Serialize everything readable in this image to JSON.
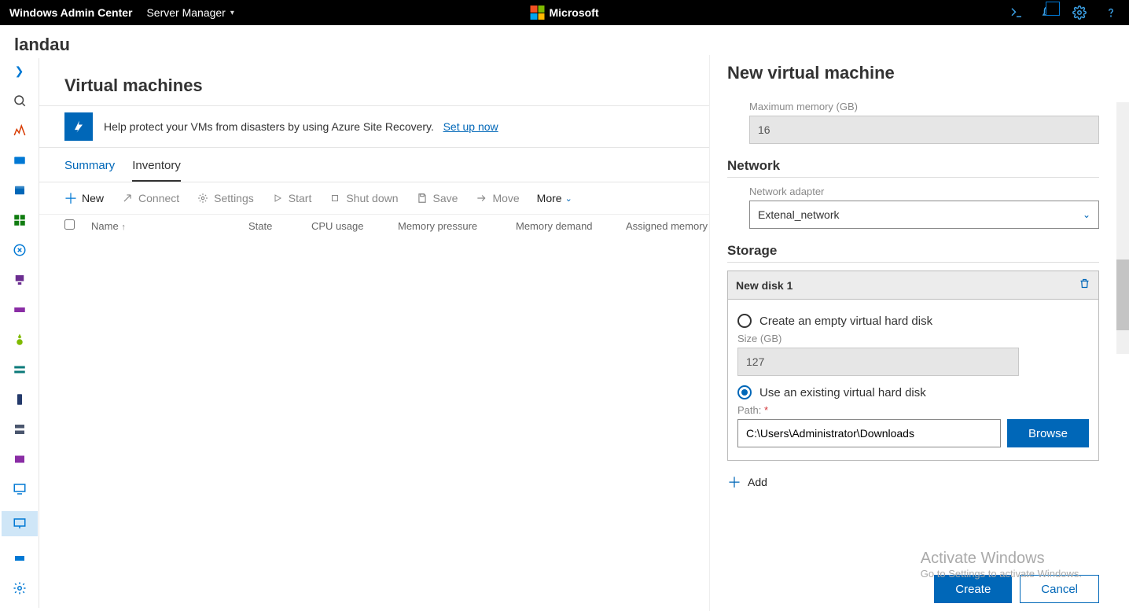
{
  "topbar": {
    "brand": "Windows Admin Center",
    "dropdown": "Server Manager",
    "center_brand": "Microsoft"
  },
  "server_name": "landau",
  "main": {
    "heading": "Virtual machines",
    "banner_text": "Help protect your VMs from disasters by using Azure Site Recovery.",
    "banner_link": "Set up now",
    "tabs": {
      "summary": "Summary",
      "inventory": "Inventory"
    },
    "cmds": {
      "new": "New",
      "connect": "Connect",
      "settings": "Settings",
      "start": "Start",
      "shutdown": "Shut down",
      "save": "Save",
      "move": "Move",
      "more": "More"
    },
    "cols": {
      "name": "Name",
      "state": "State",
      "cpu": "CPU usage",
      "mempressure": "Memory pressure",
      "memdemand": "Memory demand",
      "assigned": "Assigned memory"
    }
  },
  "panel": {
    "title": "New virtual machine",
    "max_mem_label": "Maximum memory (GB)",
    "max_mem_value": "16",
    "network_title": "Network",
    "adapter_label": "Network adapter",
    "adapter_value": "Extenal_network",
    "storage_title": "Storage",
    "disk_title": "New disk 1",
    "create_empty": "Create an empty virtual hard disk",
    "size_label": "Size (GB)",
    "size_value": "127",
    "use_existing": "Use an existing virtual hard disk",
    "path_label": "Path:",
    "path_value": "C:\\Users\\Administrator\\Downloads",
    "browse": "Browse",
    "add": "Add",
    "create": "Create",
    "cancel": "Cancel"
  },
  "watermark": {
    "ln1": "Activate Windows",
    "ln2": "Go to Settings to activate Windows."
  }
}
